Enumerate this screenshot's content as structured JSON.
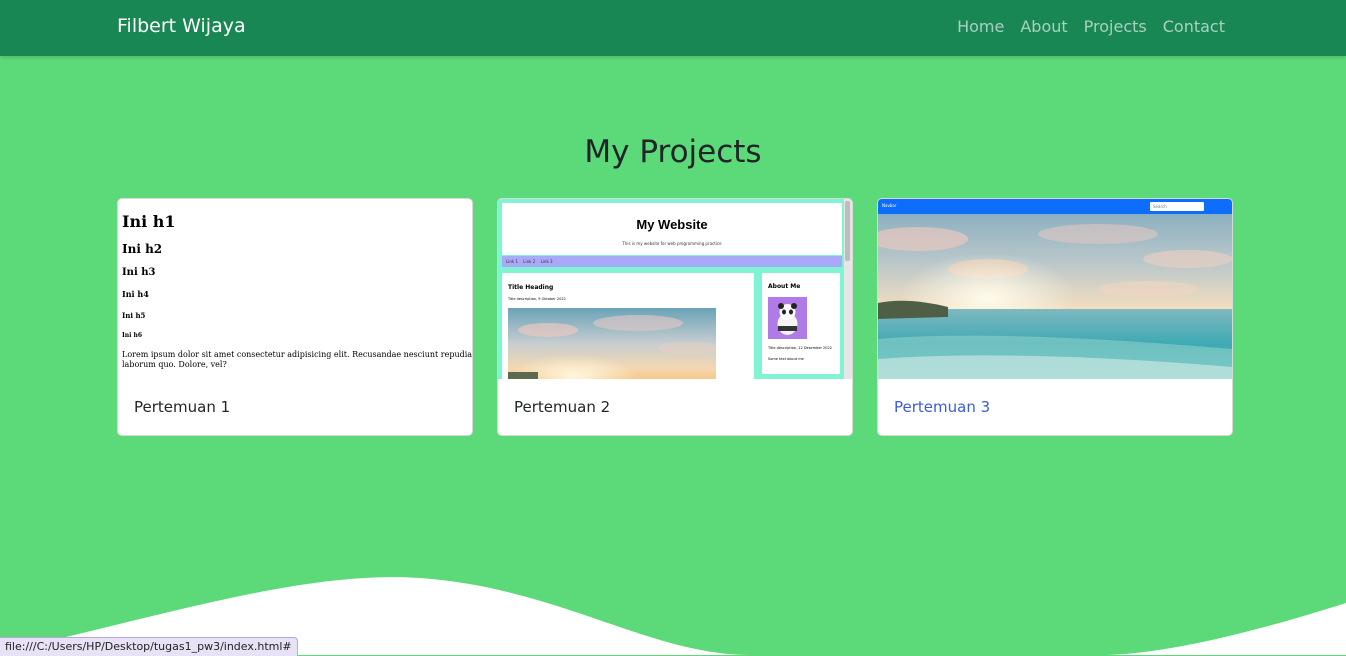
{
  "navbar": {
    "brand": "Filbert Wijaya",
    "links": [
      "Home",
      "About",
      "Projects",
      "Contact"
    ]
  },
  "page_title": "My Projects",
  "cards": [
    {
      "title": "Pertemuan 1",
      "preview": {
        "headings": [
          "Ini h1",
          "Ini h2",
          "Ini h3",
          "Ini h4",
          "Ini h5",
          "Ini h6"
        ],
        "paragraph_line1": "Lorem ipsum dolor sit amet consectetur adipisicing elit. Recusandae nesciunt repudiandae commodi",
        "paragraph_line2": "laborum quo. Dolore, vel?"
      }
    },
    {
      "title": "Pertemuan 2",
      "preview": {
        "site_title": "My Website",
        "site_subtitle": "This is my website for web programming practice",
        "nav_links": [
          "Link 1",
          "Link 2",
          "Link 3"
        ],
        "heading": "Title Heading",
        "description": "Title description, 9 Oktober 2022",
        "about_title": "About Me",
        "about_caption": "Title description, 12 Desember 2022",
        "about_text": "Some text about me"
      }
    },
    {
      "title": "Pertemuan 3",
      "preview": {
        "navbar_text": "Navbar",
        "search_placeholder": "Search"
      }
    }
  ],
  "status_url": "file:///C:/Users/HP/Desktop/tugas1_pw3/index.html#",
  "colors": {
    "background": "#5cd978",
    "navbar": "#198754",
    "link": "#3b5bdb"
  }
}
